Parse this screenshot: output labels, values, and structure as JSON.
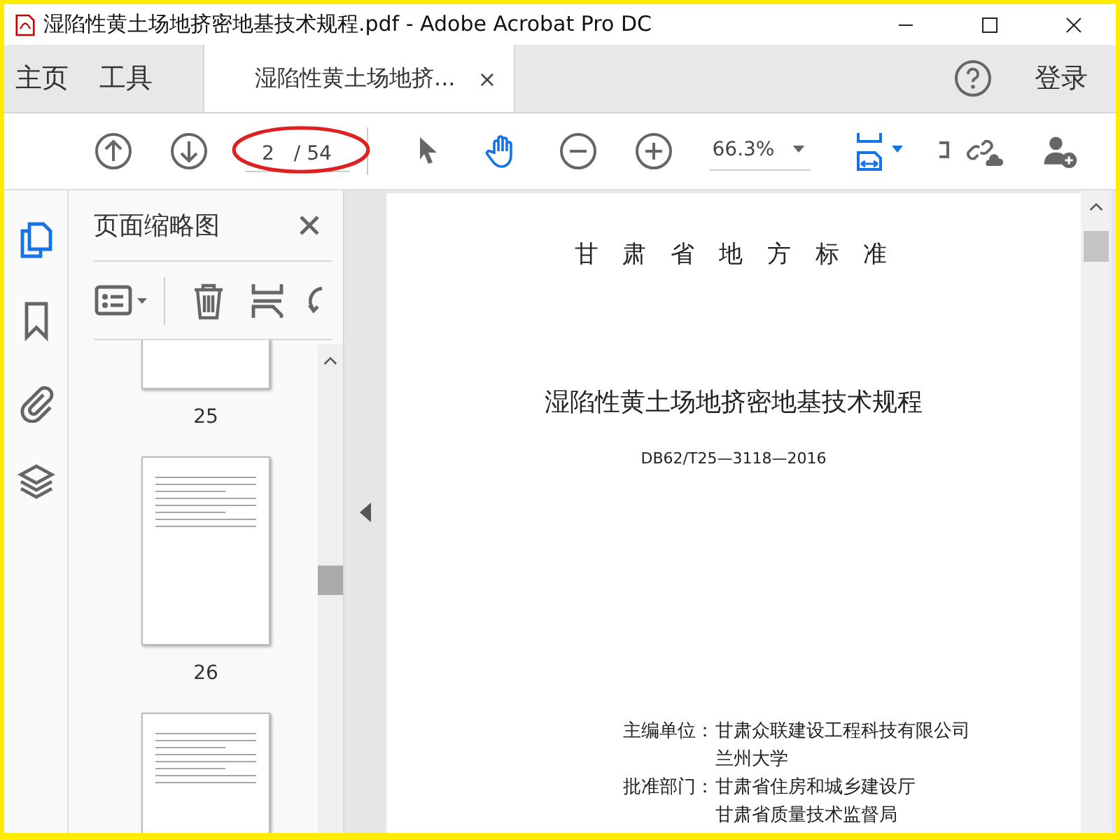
{
  "window": {
    "title": "湿陷性黄土场地挤密地基技术规程.pdf - Adobe Acrobat Pro DC"
  },
  "nav_tabs": [
    {
      "label": "主页",
      "selected": false
    },
    {
      "label": "工具",
      "selected": false
    },
    {
      "label": "湿陷性黄土场地挤...",
      "selected": true,
      "close": "×"
    }
  ],
  "account": {
    "login": "登录"
  },
  "toolbar": {
    "page_current": "2",
    "page_total": "/ 54",
    "zoom": "66.3%",
    "hand_tool_selected": true
  },
  "sidebar": {
    "rail": [
      {
        "kind": "pages",
        "selected": true
      },
      {
        "kind": "bookmarks",
        "selected": false
      },
      {
        "kind": "attachments",
        "selected": false
      },
      {
        "kind": "layers",
        "selected": false
      }
    ],
    "panel_title": "页面缩略图",
    "thumbnails": [
      "25",
      "26"
    ]
  },
  "document": {
    "header": "甘 肃 省 地 方 标 准",
    "title": "湿陷性黄土场地挤密地基技术规程",
    "code": "DB62/T25—3118—2016",
    "credits": [
      {
        "label": "主编单位：",
        "values": [
          "甘肃众联建设工程科技有限公司",
          "兰州大学"
        ]
      },
      {
        "label": "批准部门：",
        "values": [
          "甘肃省住房和城乡建设厅",
          "甘肃省质量技术监督局"
        ]
      }
    ]
  }
}
